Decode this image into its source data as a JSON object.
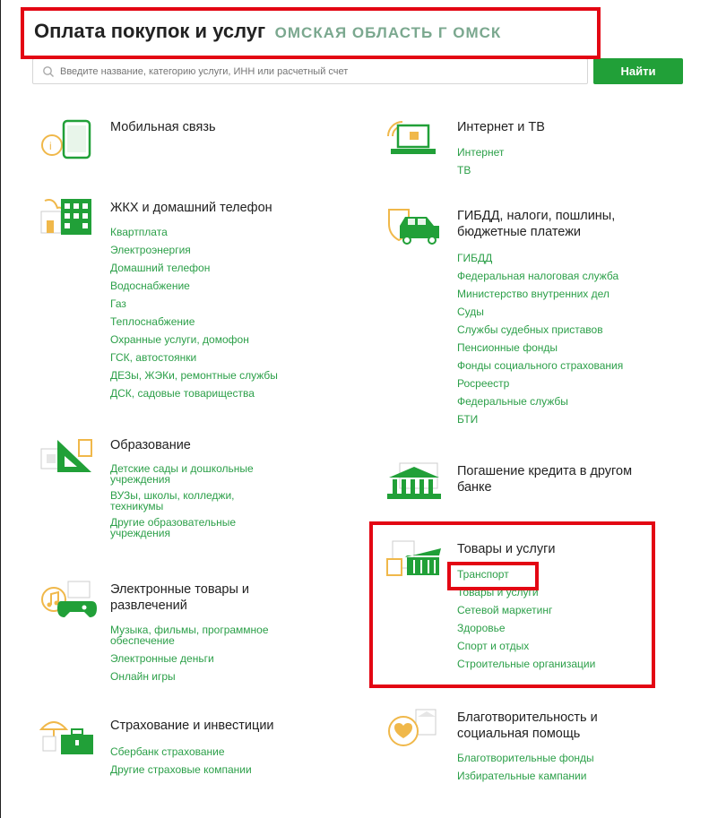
{
  "header": {
    "title": "Оплата покупок и услуг",
    "region": "ОМСКАЯ ОБЛАСТЬ Г ОМСК"
  },
  "search": {
    "placeholder": "Введите название, категорию услуги, ИНН или расчетный счет",
    "button_label": "Найти"
  },
  "colors": {
    "accent": "#21a038",
    "link": "#2b9f48",
    "highlight": "#e30613"
  },
  "categories": [
    {
      "title": "Мобильная связь",
      "icon": "mobile-phone-icon",
      "items": []
    },
    {
      "title": "Интернет и ТВ",
      "icon": "laptop-wifi-icon",
      "items": [
        "Интернет",
        "ТВ"
      ]
    },
    {
      "title": "ЖКХ и домашний телефон",
      "icon": "house-utilities-icon",
      "items": [
        "Квартплата",
        "Электроэнергия",
        "Домашний телефон",
        "Водоснабжение",
        "Газ",
        "Теплоснабжение",
        "Охранные услуги, домофон",
        "ГСК, автостоянки",
        "ДЕЗы, ЖЭКи, ремонтные службы",
        "ДСК, садовые товарищества"
      ]
    },
    {
      "title_line1": "ГИБДД, налоги, пошлины,",
      "title_line2": "бюджетные платежи",
      "icon": "car-shield-icon",
      "items": [
        "ГИБДД",
        "Федеральная налоговая служба",
        "Министерство внутренних дел",
        "Суды",
        "Службы судебных приставов",
        "Пенсионные фонды",
        "Фонды социального страхования",
        "Росреестр",
        "Федеральные службы",
        "БТИ"
      ]
    },
    {
      "title": "Образование",
      "icon": "ruler-triangle-icon",
      "items": [
        "Детские сады и дошкольные учреждения",
        "ВУЗы, школы, колледжи, техникумы",
        "Другие образовательные учреждения"
      ]
    },
    {
      "title_line1": "Погашение кредита в другом",
      "title_line2": "банке",
      "icon": "bank-building-icon",
      "items": []
    },
    {
      "title": "Товары и услуги",
      "icon": "shopping-basket-icon",
      "items": [
        "Транспорт",
        "Товары и услуги",
        "Сетевой маркетинг",
        "Здоровье",
        "Спорт и отдых",
        "Строительные организации"
      ]
    },
    {
      "title_line1": "Электронные товары и",
      "title_line2": "развлечений",
      "icon": "music-gamepad-icon",
      "items": [
        "Музыка, фильмы, программное обеспечение",
        "Электронные деньги",
        "Онлайн игры"
      ]
    },
    {
      "title": "Страхование и инвестиции",
      "icon": "umbrella-briefcase-icon",
      "items": [
        "Сбербанк страхование",
        "Другие страховые компании"
      ]
    },
    {
      "title_line1": "Благотворительность и",
      "title_line2": "социальная помощь",
      "icon": "charity-heart-icon",
      "items": [
        "Благотворительные фонды",
        "Избирательные кампании"
      ]
    }
  ]
}
